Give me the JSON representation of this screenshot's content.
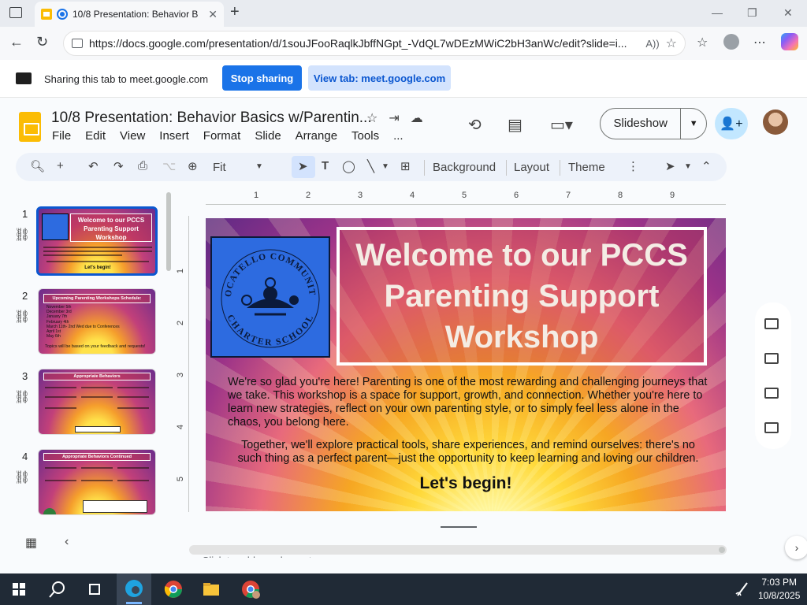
{
  "browser": {
    "tab_title": "10/8 Presentation: Behavior B",
    "url": "https://docs.google.com/presentation/d/1souJFooRaqlkJbffNGpt_-VdQL7wDEzMWiC2bH3anWc/edit?slide=i..."
  },
  "sharing_bar": {
    "text": "Sharing this tab to meet.google.com",
    "stop_label": "Stop sharing",
    "view_label": "View tab: meet.google.com"
  },
  "slides": {
    "title": "10/8 Presentation: Behavior Basics w/Parentin...",
    "menu": [
      "File",
      "Edit",
      "View",
      "Insert",
      "Format",
      "Slide",
      "Arrange",
      "Tools",
      "..."
    ],
    "slideshow_label": "Slideshow",
    "toolbar": {
      "zoom": "Fit",
      "background": "Background",
      "layout": "Layout",
      "theme": "Theme"
    },
    "ruler_h": [
      "1",
      "2",
      "3",
      "4",
      "5",
      "6",
      "7",
      "8",
      "9"
    ],
    "ruler_v": [
      "1",
      "2",
      "3",
      "4",
      "5"
    ],
    "filmstrip": [
      {
        "num": "1",
        "title": "Welcome to our PCCS Parenting Support Workshop",
        "footer": "Let's begin!"
      },
      {
        "num": "2",
        "title": "Upcoming Parenting Workshops Schedule:",
        "items": [
          "November 5th",
          "December 3rd",
          "January 7th",
          "February 4th",
          "March 11th- 2nd Wed due to Conferences",
          "April 1st",
          "May 6th"
        ],
        "footer": "Topics will be based on your feedback and requests!"
      },
      {
        "num": "3",
        "title": "Appropriate Behaviors"
      },
      {
        "num": "4",
        "title": "Appropriate Behaviors Continued"
      }
    ],
    "current_slide": {
      "logo_text_top": "POCATELLO COMMUNITY",
      "logo_text_bottom": "CHARTER SCHOOL",
      "title_lines": [
        "Welcome to our PCCS",
        "Parenting Support",
        "Workshop"
      ],
      "paragraph1": "We're so glad you're here! Parenting is one of the most rewarding and challenging journeys that we take. This workshop is a space for support, growth, and connection. Whether you're here to learn new strategies, reflect on your own parenting style, or to simply feel less alone in the chaos, you belong here.",
      "paragraph2": "Together, we'll explore practical tools, share experiences, and remind ourselves: there's no such thing as a perfect parent—just the opportunity to keep learning and loving our children.",
      "closing": "Let's begin!"
    },
    "notes_placeholder": "Click to add speaker notes"
  },
  "taskbar": {
    "time": "7:03 PM",
    "date": "10/8/2025"
  },
  "colors": {
    "accent": "#1a73e8",
    "toolbar_bg": "#edf2fa",
    "taskbar_bg": "#202a36"
  }
}
